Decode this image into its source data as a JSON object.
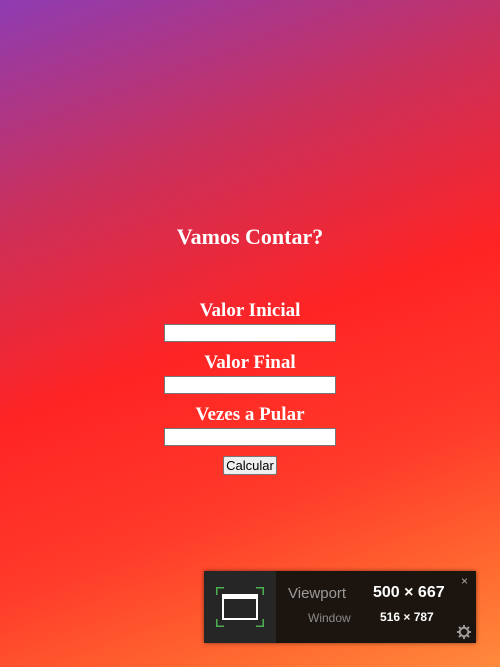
{
  "page": {
    "title": "Vamos Contar?"
  },
  "form": {
    "fields": [
      {
        "label": "Valor Inicial",
        "value": ""
      },
      {
        "label": "Valor Final",
        "value": ""
      },
      {
        "label": "Vezes a Pular",
        "value": ""
      }
    ],
    "submit_label": "Calcular"
  },
  "viewport_widget": {
    "viewport_label": "Viewport",
    "viewport_value": "500 × 667",
    "window_label": "Window",
    "window_value": "516 × 787",
    "close_symbol": "×",
    "accent_color": "#4caf50"
  },
  "colors": {
    "gradient_top": "#8e3cb3",
    "gradient_mid": "#ff2424",
    "gradient_bottom": "#ff8a3c"
  }
}
